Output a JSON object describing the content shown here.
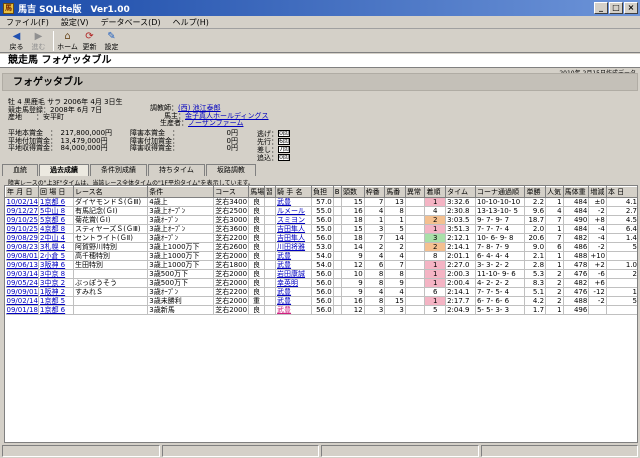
{
  "window": {
    "title": "馬吉 SQLite版　Ver1.00"
  },
  "menu": [
    "ファイル(F)",
    "設定(V)",
    "データベース(D)",
    "ヘルプ(H)"
  ],
  "toolbar": {
    "back": "戻る",
    "forward": "進む",
    "home": "ホーム",
    "refresh": "更新",
    "settings": "設定"
  },
  "page": {
    "header": "競走馬 フォゲッタブル",
    "title": "フォゲッタブル",
    "created": "2010年 2月15日作成データ"
  },
  "horse": {
    "profile": "牡 4 黒鹿毛 サラ 2006年 4月 3日生",
    "registered": "競走馬登録：2008年 6月 7日",
    "origin": "産地　　：安平町",
    "trainer_label": "調教師：",
    "trainer": "(西) 池江泰郎",
    "owner_label": "馬主：",
    "owner": "金子真人ホールディングス",
    "breeder_label": "生産者：",
    "breeder": "ノーザンファーム",
    "flat_prize": "平地本賞金　：　217,800,000円",
    "flat_add": "平地付加賞金：　13,479,000円",
    "flat_earn": "平地収得賞金：　84,000,000円",
    "steeple_prize": "障害本賞金　：",
    "steeple_add": "障害付加賞金：",
    "steeple_earn": "障害収得賞金：",
    "zero": "0円",
    "style": [
      {
        "label": "逃げ：",
        "val": "0回"
      },
      {
        "label": "先行：",
        "val": "6回"
      },
      {
        "label": "差し：",
        "val": "7回"
      },
      {
        "label": "追込：",
        "val": "0回"
      }
    ]
  },
  "tabs": [
    "血統",
    "過去成績",
    "条件別成績",
    "持ちタイム",
    "坂路調教"
  ],
  "note": "障害レースの\"上3F\"タイムは、当該レース全体タイムの\"1F平均タイム\"を表示しています。",
  "columns": [
    "年 月 日",
    "回 場 日",
    "レース名",
    "条件",
    "コース",
    "馬場",
    "習",
    "騎 手 名",
    "負担",
    "B",
    "頭数",
    "枠番",
    "馬番",
    "異常",
    "着順",
    "タイム",
    "コーナ通過順",
    "単勝",
    "人気",
    "馬体重",
    "増減",
    "本 日"
  ],
  "rows": [
    [
      "10/02/14",
      "1京都 6",
      "ダイヤモンドＳ(ＧⅢ)",
      "4歳上",
      "芝右3400",
      "良",
      "",
      "武豊",
      "57.0",
      "",
      "15",
      "7",
      "13",
      "",
      "1",
      "3:32.6",
      "10-10-10-10",
      "2.2",
      "1",
      "484",
      "±0",
      "4.1"
    ],
    [
      "09/12/27",
      "5中山 8",
      "有馬記念(ＧⅠ)",
      "3歳上ｵｰﾌﾟﾝ",
      "芝右2500",
      "良",
      "",
      "ルメール",
      "55.0",
      "",
      "16",
      "4",
      "8",
      "",
      "4",
      "2:30.8",
      "13-13-10- 5",
      "9.6",
      "4",
      "484",
      "-2",
      "2.7"
    ],
    [
      "09/10/25",
      "5京都 6",
      "菊花賞(ＧⅠ)",
      "3歳ｵｰﾌﾟﾝ",
      "芝右3000",
      "良",
      "",
      "スミヨン",
      "56.0",
      "",
      "18",
      "1",
      "1",
      "",
      "2",
      "3:03.5",
      "9- 7- 9- 7",
      "18.7",
      "7",
      "490",
      "+8",
      "4.5"
    ],
    [
      "09/10/25",
      "4京都 8",
      "スティヤーズＳ(ＧⅢ)",
      "3歳上ｵｰﾌﾟﾝ",
      "芝右3600",
      "良",
      "",
      "吉田隼人",
      "55.0",
      "",
      "15",
      "3",
      "5",
      "",
      "1",
      "3:51.3",
      "7- 7- 7- 4",
      "2.0",
      "1",
      "484",
      "-4",
      "6.4"
    ],
    [
      "09/08/29",
      "2中山 4",
      "セントライト(ＧⅡ)",
      "3歳ｵｰﾌﾟﾝ",
      "芝右2200",
      "良",
      "",
      "吉田隼人",
      "56.0",
      "",
      "18",
      "7",
      "14",
      "",
      "3",
      "2:12.1",
      "10- 6- 9- 8",
      "20.6",
      "7",
      "482",
      "-4",
      "1.4"
    ],
    [
      "09/08/23",
      "3札幌 4",
      "阿賀野川特別",
      "3歳上1000万下",
      "芝右2600",
      "良",
      "",
      "川田将雅",
      "53.0",
      "",
      "14",
      "2",
      "2",
      "",
      "2",
      "2:14.1",
      "7- 8- 7- 9",
      "9.0",
      "6",
      "486",
      "-2",
      "5"
    ],
    [
      "09/08/01",
      "2小倉 5",
      "高千穂特別",
      "3歳上1000万下",
      "芝右2000",
      "良",
      "",
      "武豊",
      "54.0",
      "",
      "9",
      "4",
      "4",
      "",
      "8",
      "2:01.1",
      "6- 4- 4- 4",
      "2.1",
      "1",
      "488",
      "+10",
      ""
    ],
    [
      "09/06/13",
      "3阪神 6",
      "生田特別",
      "3歳上1000万下",
      "芝右1800",
      "良",
      "",
      "武豊",
      "54.0",
      "",
      "12",
      "6",
      "7",
      "",
      "1",
      "2:27.0",
      "3- 3- 2- 2",
      "2.8",
      "1",
      "478",
      "+2",
      "1.0"
    ],
    [
      "09/03/14",
      "3中京 8",
      "",
      "3歳500万下",
      "芝右2000",
      "良",
      "",
      "岩田康誠",
      "56.0",
      "",
      "10",
      "8",
      "8",
      "",
      "1",
      "2:00.3",
      "11-10- 9- 6",
      "5.3",
      "2",
      "476",
      "-6",
      "2"
    ],
    [
      "09/05/24",
      "3中京 2",
      "ぶっぽうそう",
      "3歳500万下",
      "芝右2000",
      "良",
      "",
      "幸英明",
      "56.0",
      "",
      "9",
      "8",
      "9",
      "",
      "1",
      "2:00.4",
      "4- 2- 2- 2",
      "8.3",
      "2",
      "482",
      "+6",
      ""
    ],
    [
      "09/09/01",
      "1阪神 2",
      "すみれＳ",
      "3歳ｵｰﾌﾟﾝ",
      "芝右2200",
      "良",
      "",
      "武豊",
      "56.0",
      "",
      "9",
      "4",
      "4",
      "",
      "6",
      "2:14.1",
      "7- 7- 5- 4",
      "5.1",
      "2",
      "476",
      "-12",
      "1"
    ],
    [
      "09/02/14",
      "1京都 5",
      "",
      "3歳未勝利",
      "芝右2000",
      "重",
      "",
      "武豊",
      "56.0",
      "",
      "16",
      "8",
      "15",
      "",
      "1",
      "2:17.7",
      "6- 7- 6- 6",
      "4.2",
      "2",
      "488",
      "-2",
      "5"
    ],
    [
      "09/01/18",
      "1京都 6",
      "",
      "3歳新馬",
      "芝右2000",
      "良",
      "",
      "武豊",
      "56.0",
      "",
      "12",
      "3",
      "3",
      "",
      "5",
      "2:04.9",
      "5- 5- 3- 3",
      "1.7",
      "1",
      "496",
      "",
      ""
    ]
  ]
}
